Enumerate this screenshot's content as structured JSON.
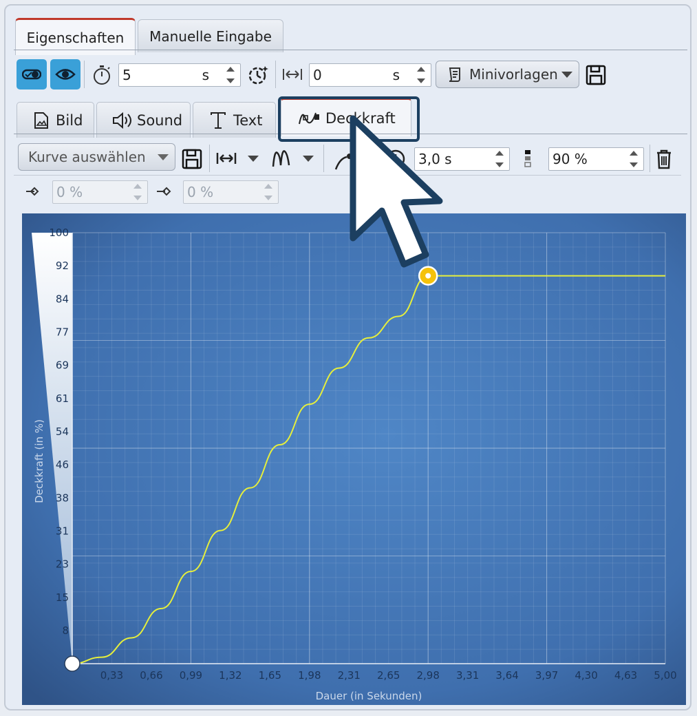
{
  "tabs": [
    {
      "label": "Eigenschaften",
      "active": true
    },
    {
      "label": "Manuelle Eingabe",
      "active": false
    }
  ],
  "toolbar": {
    "duration_value": "5",
    "duration_unit": "s",
    "offset_value": "0",
    "offset_unit": "s",
    "templates_label": "Minivorlagen"
  },
  "sub_tabs": [
    {
      "label": "Bild",
      "icon": "image-file-icon"
    },
    {
      "label": "Sound",
      "icon": "speaker-icon"
    },
    {
      "label": "Text",
      "icon": "text-t-icon"
    },
    {
      "label": "Deckkraft",
      "icon": "opacity-curve-icon",
      "active": true
    }
  ],
  "curve_toolbar": {
    "select_curve_label": "Kurve auswählen",
    "time_value": "3,0 s",
    "opacity_value": "90 %",
    "start_value": "0 %",
    "end_value": "0 %"
  },
  "colors": {
    "accent_blue": "#3aa0d8",
    "tab_active_border": "#c0392b",
    "highlight": "#1c3f60",
    "curve": "#e6ef3c",
    "keyframe": "#f5c20b"
  },
  "chart_data": {
    "type": "line",
    "xlabel": "Dauer (in Sekunden)",
    "ylabel": "Deckkraft (in %)",
    "x_ticks": [
      "0,33",
      "0,66",
      "0,99",
      "1,32",
      "1,65",
      "1,98",
      "2,31",
      "2,65",
      "2,98",
      "3,31",
      "3,64",
      "3,97",
      "4,30",
      "4,63",
      "5,00"
    ],
    "y_ticks": [
      "100",
      "92",
      "84",
      "77",
      "69",
      "61",
      "54",
      "46",
      "38",
      "31",
      "23",
      "15",
      "8"
    ],
    "xlim": [
      0,
      5
    ],
    "ylim": [
      0,
      100
    ],
    "grid": true,
    "series": [
      {
        "x": [
          0,
          0.25,
          0.5,
          0.75,
          1.0,
          1.25,
          1.5,
          1.75,
          2.0,
          2.25,
          2.5,
          2.75,
          3.0,
          3.5,
          4.0,
          4.5,
          5.0
        ],
        "y": [
          0,
          1.5,
          6,
          12.8,
          21.4,
          30.9,
          40.8,
          50.8,
          60.2,
          68.6,
          75.6,
          80.6,
          90,
          90,
          90,
          90,
          90
        ]
      }
    ],
    "keyframes": [
      {
        "x": 0,
        "y": 0
      },
      {
        "x": 3.0,
        "y": 90
      }
    ]
  }
}
